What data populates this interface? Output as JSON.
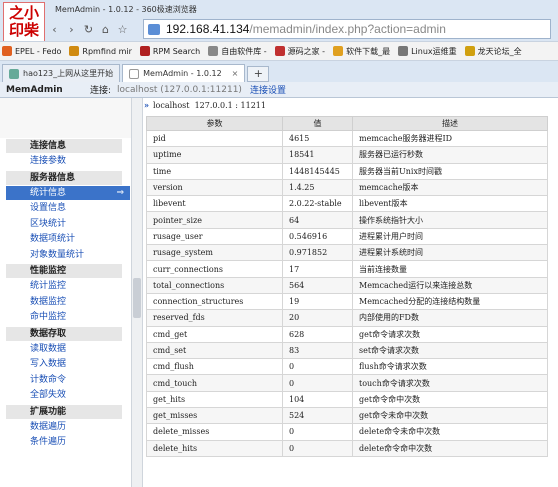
{
  "browser": {
    "window_title": "MemAdmin - 1.0.12 - 360极速浏览器",
    "logo_text": "之小印柴",
    "nav": {
      "back": "‹",
      "forward": "›",
      "refresh": "↻",
      "home": "⌂",
      "bookmark": "☆"
    },
    "url_host": "192.168.41.134",
    "url_path": "/memadmin/index.php?action=admin",
    "favorites": [
      {
        "label": "EPEL - Fedo",
        "color": "#e06020"
      },
      {
        "label": "Rpmfind mir",
        "color": "#d08a10"
      },
      {
        "label": "RPM Search",
        "color": "#b02020"
      },
      {
        "label": "自由软件库 -",
        "color": "#888888"
      },
      {
        "label": "源码之家 -",
        "color": "#c03030"
      },
      {
        "label": "软件下载_最",
        "color": "#e0a020"
      },
      {
        "label": "Linux运维重",
        "color": "#777777"
      },
      {
        "label": "龙天论坛_全",
        "color": "#d0a010"
      }
    ],
    "tabs": [
      {
        "label": "hao123_上网从这里开始",
        "active": false
      },
      {
        "label": "MemAdmin - 1.0.12",
        "active": true
      }
    ],
    "new_tab": "+",
    "tab_close": "×"
  },
  "app": {
    "name": "MemAdmin",
    "connection_label": "连接:",
    "connection_value": "localhost (127.0.0.1:11211)",
    "connection_settings": "连接设置"
  },
  "sidebar": {
    "sections": [
      {
        "title": "连接信息",
        "items": [
          "连接参数"
        ]
      },
      {
        "title": "服务器信息",
        "items": [
          "统计信息",
          "设置信息",
          "区块统计",
          "数据项统计",
          "对象数量统计"
        ]
      },
      {
        "title": "性能监控",
        "items": [
          "统计监控",
          "数据监控",
          "命中监控"
        ]
      },
      {
        "title": "数据存取",
        "items": [
          "读取数据",
          "写入数据",
          "计数命令",
          "全部失效"
        ]
      },
      {
        "title": "扩展功能",
        "items": [
          "数据遍历",
          "条件遍历"
        ]
      }
    ],
    "selected": "统计信息",
    "selected_arrow": "⇒"
  },
  "main": {
    "crumb_marker": "»",
    "crumb_host": "localhost",
    "crumb_addr": "127.0.0.1 : 11211",
    "columns": [
      "参数",
      "值",
      "描述"
    ],
    "rows": [
      [
        "pid",
        "4615",
        "memcache服务器进程ID"
      ],
      [
        "uptime",
        "18541",
        "服务器已运行秒数"
      ],
      [
        "time",
        "1448145445",
        "服务器当前Unix时间戳"
      ],
      [
        "version",
        "1.4.25",
        "memcache版本"
      ],
      [
        "libevent",
        "2.0.22-stable",
        "libevent版本"
      ],
      [
        "pointer_size",
        "64",
        "操作系统指针大小"
      ],
      [
        "rusage_user",
        "0.546916",
        "进程累计用户时间"
      ],
      [
        "rusage_system",
        "0.971852",
        "进程累计系统时间"
      ],
      [
        "curr_connections",
        "17",
        "当前连接数量"
      ],
      [
        "total_connections",
        "564",
        "Memcached运行以来连接总数"
      ],
      [
        "connection_structures",
        "19",
        "Memcached分配的连接结构数量"
      ],
      [
        "reserved_fds",
        "20",
        "内部使用的FD数"
      ],
      [
        "cmd_get",
        "628",
        "get命令请求次数"
      ],
      [
        "cmd_set",
        "83",
        "set命令请求次数"
      ],
      [
        "cmd_flush",
        "0",
        "flush命令请求次数"
      ],
      [
        "cmd_touch",
        "0",
        "touch命令请求次数"
      ],
      [
        "get_hits",
        "104",
        "get命令命中次数"
      ],
      [
        "get_misses",
        "524",
        "get命令未命中次数"
      ],
      [
        "delete_misses",
        "0",
        "delete命令未命中次数"
      ],
      [
        "delete_hits",
        "0",
        "delete命令命中次数"
      ]
    ]
  }
}
